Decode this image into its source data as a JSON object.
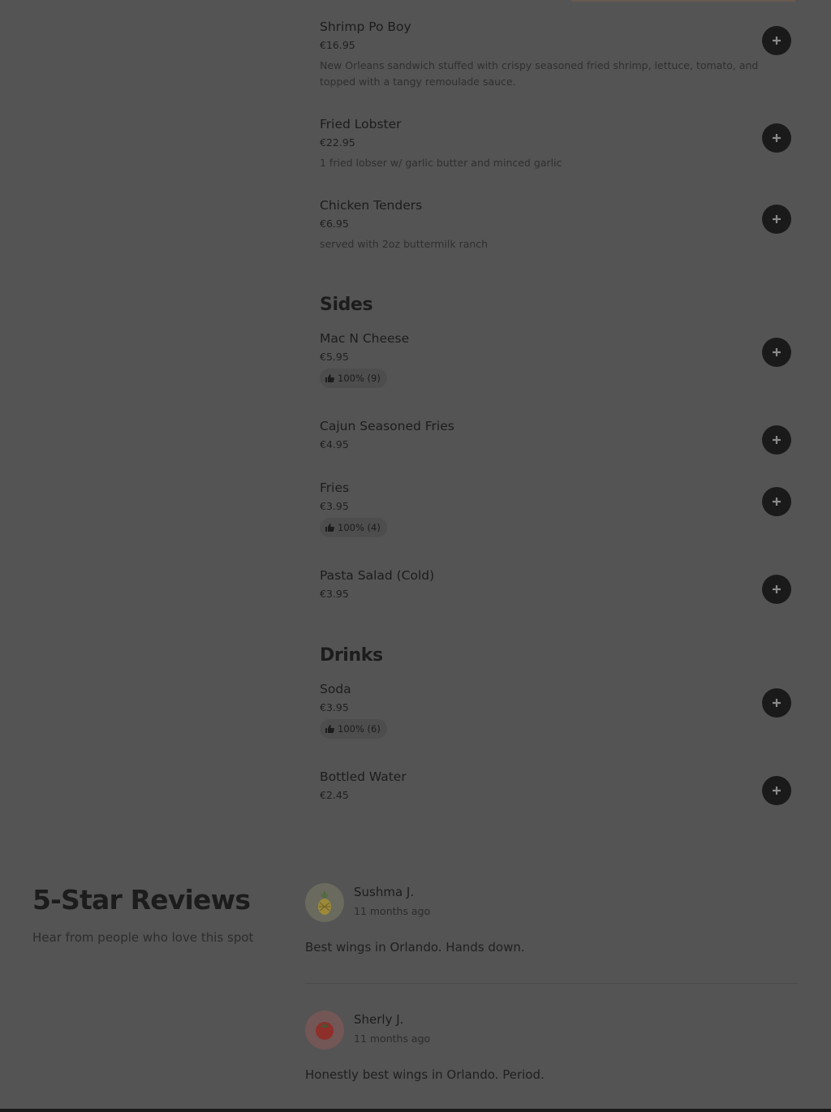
{
  "menu": {
    "items_top": [
      {
        "name": "Shrimp Po Boy",
        "price": "€16.95",
        "description": "New Orleans sandwich stuffed with crispy seasoned fried shrimp, lettuce, tomato, and topped with a tangy remoulade sauce."
      },
      {
        "name": "Fried Lobster",
        "price": "€22.95",
        "description": "1 fried lobser w/ garlic butter and minced garlic"
      },
      {
        "name": "Chicken Tenders",
        "price": "€6.95",
        "description": "served with 2oz buttermilk ranch"
      }
    ],
    "sides": {
      "title": "Sides",
      "items": [
        {
          "name": "Mac N Cheese",
          "price": "€5.95",
          "rating": "100% (9)"
        },
        {
          "name": "Cajun Seasoned Fries",
          "price": "€4.95"
        },
        {
          "name": "Fries",
          "price": "€3.95",
          "rating": "100% (4)"
        },
        {
          "name": "Pasta Salad (Cold)",
          "price": "€3.95"
        }
      ]
    },
    "drinks": {
      "title": "Drinks",
      "items": [
        {
          "name": "Soda",
          "price": "€3.95",
          "rating": "100% (6)"
        },
        {
          "name": "Bottled Water",
          "price": "€2.45"
        }
      ]
    }
  },
  "reviews": {
    "title": "5-Star Reviews",
    "subtitle": "Hear from people who love this spot",
    "entries": [
      {
        "name": "Sushma J.",
        "time": "11 months ago",
        "text": "Best wings in Orlando. Hands down.",
        "avatar_icon": "pineapple-icon",
        "avatar_color": "#7a7a6a"
      },
      {
        "name": "Sherly J.",
        "time": "11 months ago",
        "text": "Honestly best wings in Orlando. Period.",
        "avatar_icon": "tomato-icon",
        "avatar_color": "#7a5e5e"
      }
    ]
  },
  "colors": {
    "overlay_background": "#545454",
    "button": "#1a1a1a",
    "text": "#1c1c1c"
  }
}
